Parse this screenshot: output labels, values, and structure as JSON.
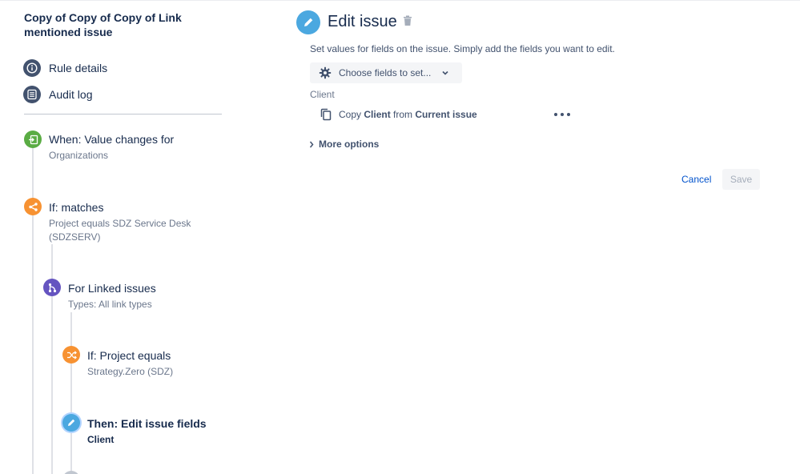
{
  "rule": {
    "title": "Copy of Copy of Copy of Link mentioned issue"
  },
  "nav": [
    {
      "label": "Rule details",
      "icon": "info-icon"
    },
    {
      "label": "Audit log",
      "icon": "list-icon"
    }
  ],
  "steps": [
    {
      "title": "When: Value changes for",
      "sub": "Organizations",
      "icon": "trigger-icon",
      "color": "#5aac44"
    },
    {
      "title": "If: matches",
      "sub": "Project equals SDZ Service Desk (SDZSERV)",
      "icon": "branch-condition-icon",
      "color": "#f79232"
    },
    {
      "title": "For Linked issues",
      "sub": "Types: All link types",
      "icon": "linked-branch-icon",
      "color": "#6554c0"
    },
    {
      "title": "If: Project equals",
      "sub": "Strategy.Zero (SDZ)",
      "icon": "shuffle-condition-icon",
      "color": "#f79232"
    },
    {
      "title": "Then: Edit issue fields",
      "sub": "Client",
      "icon": "pencil-icon",
      "color": "#4ba8e0"
    }
  ],
  "panel": {
    "title": "Edit issue",
    "description": "Set values for fields on the issue. Simply add the fields you want to edit.",
    "choose_label": "Choose fields to set...",
    "field_label": "Client",
    "copy": {
      "prefix": "Copy ",
      "field": "Client",
      "middle": " from ",
      "source": "Current issue"
    },
    "more_options": "More options",
    "cancel": "Cancel",
    "save": "Save"
  },
  "colors": {
    "accent": "#0052cc",
    "edit_icon": "#4ba8e0",
    "nav_icon": "#42526e"
  }
}
